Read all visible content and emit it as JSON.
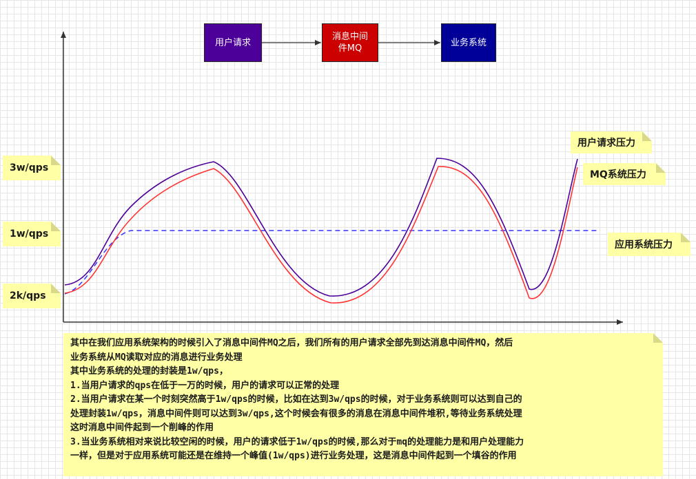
{
  "flow": {
    "user_request": "用户请求",
    "mq": "消息中间件MQ",
    "business": "业务系统"
  },
  "y_labels": {
    "high": "3w/qps",
    "mid": "1w/qps",
    "low": "2k/qps"
  },
  "legend": {
    "user_pressure": "用户请求压力",
    "mq_pressure": "MQ系统压力",
    "app_pressure": "应用系统压力"
  },
  "colors": {
    "user_request_box": "#4c0099",
    "mq_box": "#cc0000",
    "business_box": "#000099",
    "user_pressure_line": "#4c0099",
    "mq_pressure_line": "#ff3333",
    "app_pressure_line": "#3333ff",
    "note_bg": "#ffffa6"
  },
  "description": {
    "line1": "其中在我们应用系统架构的时候引入了消息中间件MQ之后，我们所有的用户请求全部先到达消息中间件MQ，然后",
    "line2": "业务系统从MQ读取对应的消息进行业务处理",
    "line3": "其中业务系统的处理的封装是1w/qps，",
    "line4": "1.当用户请求的qps在低于一万的时候，用户的请求可以正常的处理",
    "line5": "2.当用户请求在某一个时刻突然高于1w/qps的时候，比如在达到3w/qps的时候，对于业务系统则可以达到自己的",
    "line6": "处理封装1w/qps，消息中间件则可以达到3w/qps,这个时候会有很多的消息在消息中间件堆积,等待业务系统处理",
    "line7": "这时消息中间件起到一个削峰的作用",
    "line8": "3.当业务系统相对来说比较空闲的时候，用户的请求低于1w/qps的时候,那么对于mq的处理能力是和用户处理能力",
    "line9": "一样，但是对于应用系统可能还是在维持一个峰值(1w/qps)进行业务处理，这是消息中间件起到一个填谷的作用"
  }
}
